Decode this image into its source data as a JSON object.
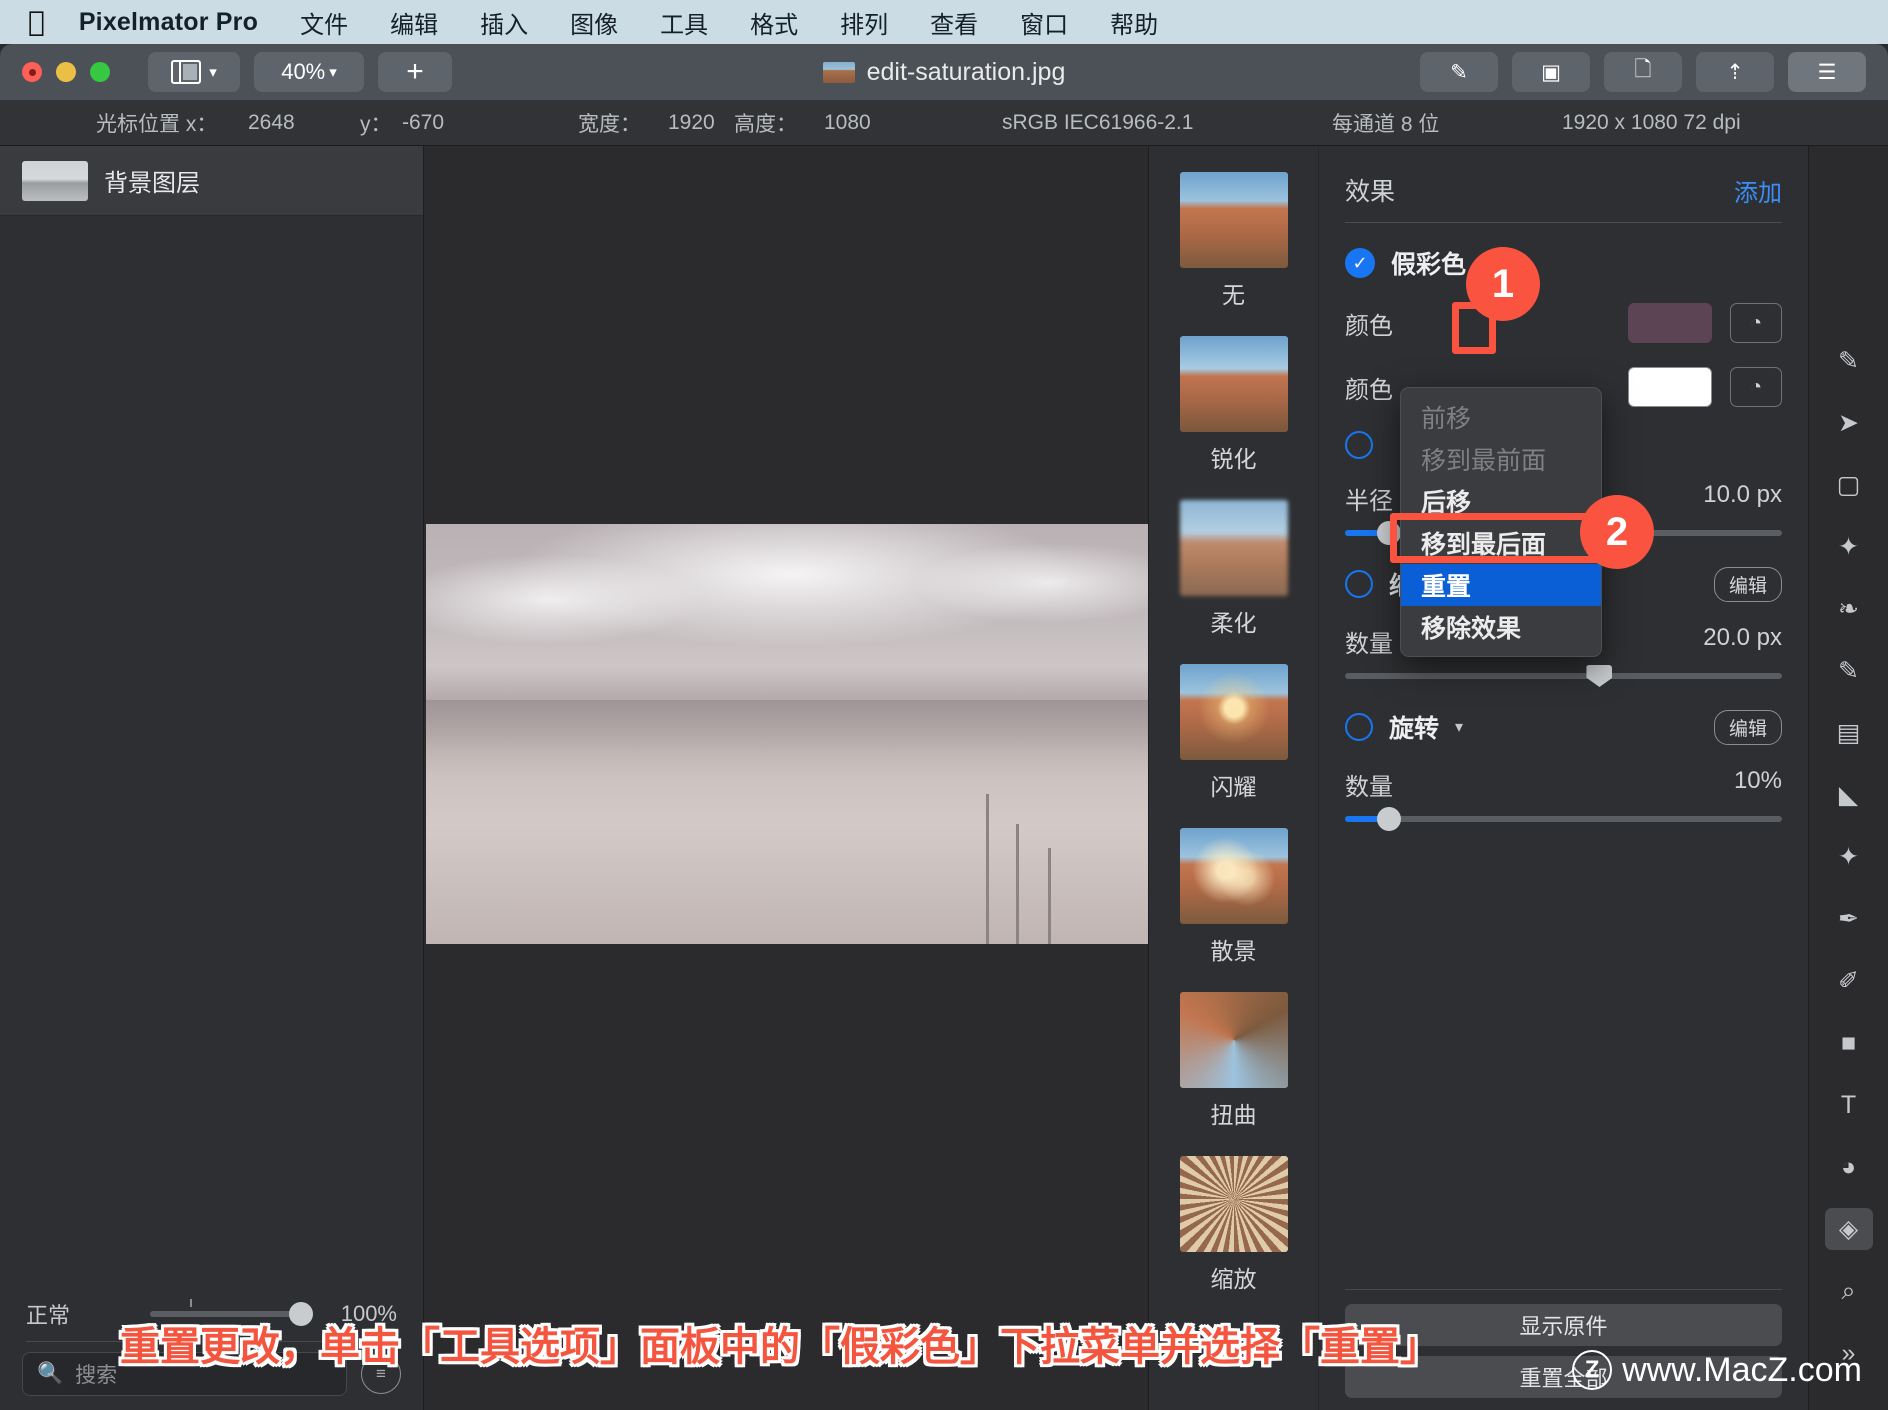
{
  "menubar": {
    "apple_icon": "apple-logo",
    "app_name": "Pixelmator Pro",
    "items": [
      {
        "label": "文件"
      },
      {
        "label": "编辑"
      },
      {
        "label": "插入"
      },
      {
        "label": "图像"
      },
      {
        "label": "工具"
      },
      {
        "label": "格式"
      },
      {
        "label": "排列"
      },
      {
        "label": "查看"
      },
      {
        "label": "窗口"
      },
      {
        "label": "帮助"
      }
    ]
  },
  "toolbar": {
    "zoom_level": "40%",
    "add_label": "+",
    "document_title": "edit-saturation.jpg"
  },
  "infobar": {
    "cursor_label": "光标位置 x：",
    "cursor_x": "2648",
    "cursor_y_label": "y：",
    "cursor_y": "-670",
    "width_label": "宽度：",
    "width": "1920",
    "height_label": "高度：",
    "height": "1080",
    "colorspace": "sRGB IEC61966-2.1",
    "bitdepth": "每通道 8 位",
    "dimensions": "1920 x 1080 72 dpi"
  },
  "layers": {
    "items": [
      {
        "name": "背景图层"
      }
    ],
    "blend_mode": "正常",
    "opacity": "100%",
    "search_placeholder": "搜索"
  },
  "presets": {
    "items": [
      {
        "label": "无",
        "thumb": "th-none"
      },
      {
        "label": "锐化",
        "thumb": "th-sharp"
      },
      {
        "label": "柔化",
        "thumb": "th-soft"
      },
      {
        "label": "闪耀",
        "thumb": "th-glow"
      },
      {
        "label": "散景",
        "thumb": "th-bokeh"
      },
      {
        "label": "扭曲",
        "thumb": "th-twist"
      },
      {
        "label": "缩放",
        "thumb": "th-zoom"
      }
    ]
  },
  "effects_panel": {
    "title": "效果",
    "add_label": "添加",
    "false_color": {
      "name": "假彩色",
      "enabled": true,
      "color1_label": "颜色",
      "color1_hex": "#5c4454",
      "color2_label": "颜色",
      "color2_hex": "#ffffff"
    },
    "blur": {
      "radius_label": "半径",
      "radius_value": "10.0 px",
      "radius_pct": 10
    },
    "zoom_effect": {
      "name": "缩放",
      "edit_label": "编辑",
      "amount_label": "数量",
      "amount_value": "20.0 px",
      "amount_pct": 58
    },
    "rotate_effect": {
      "name": "旋转",
      "edit_label": "编辑",
      "amount_label": "数量",
      "amount_value": "10%",
      "amount_pct": 10
    },
    "show_original_label": "显示原件",
    "reset_all_label": "重置全部"
  },
  "dropdown": {
    "items": [
      {
        "label": "前移",
        "state": "disabled"
      },
      {
        "label": "移到最前面",
        "state": "disabled"
      },
      {
        "label": "后移",
        "state": "normal"
      },
      {
        "label": "移到最后面",
        "state": "normal"
      },
      {
        "label": "重置",
        "state": "selected"
      },
      {
        "label": "移除效果",
        "state": "normal"
      }
    ]
  },
  "tools": {
    "items": [
      {
        "name": "retouch-icon",
        "glyph": "✎"
      },
      {
        "name": "arrange-icon",
        "glyph": "➤"
      },
      {
        "name": "rect-select-icon",
        "glyph": "▢"
      },
      {
        "name": "magic-wand-icon",
        "glyph": "✧"
      },
      {
        "name": "quick-select-icon",
        "glyph": "❧"
      },
      {
        "name": "paint-icon",
        "glyph": "🖌"
      },
      {
        "name": "gradient-icon",
        "glyph": "▤"
      },
      {
        "name": "eraser-icon",
        "glyph": "◣"
      },
      {
        "name": "clone-icon",
        "glyph": "✦"
      },
      {
        "name": "repair-icon",
        "glyph": "✑"
      },
      {
        "name": "pen-icon",
        "glyph": "✒"
      },
      {
        "name": "shape-icon",
        "glyph": "■"
      },
      {
        "name": "text-icon",
        "glyph": "T"
      },
      {
        "name": "color-adjust-icon",
        "glyph": "◕"
      },
      {
        "name": "effects-icon",
        "glyph": "◈"
      },
      {
        "name": "zoom-icon",
        "glyph": "⌕"
      },
      {
        "name": "more-tools-icon",
        "glyph": "»"
      }
    ]
  },
  "annotations": {
    "badge1": "1",
    "badge2": "2",
    "caption": "重置更改，单击「工具选项」面板中的「假彩色」下拉菜单并选择「重置」",
    "watermark": "www.MacZ.com",
    "watermark_logo": "Z"
  }
}
